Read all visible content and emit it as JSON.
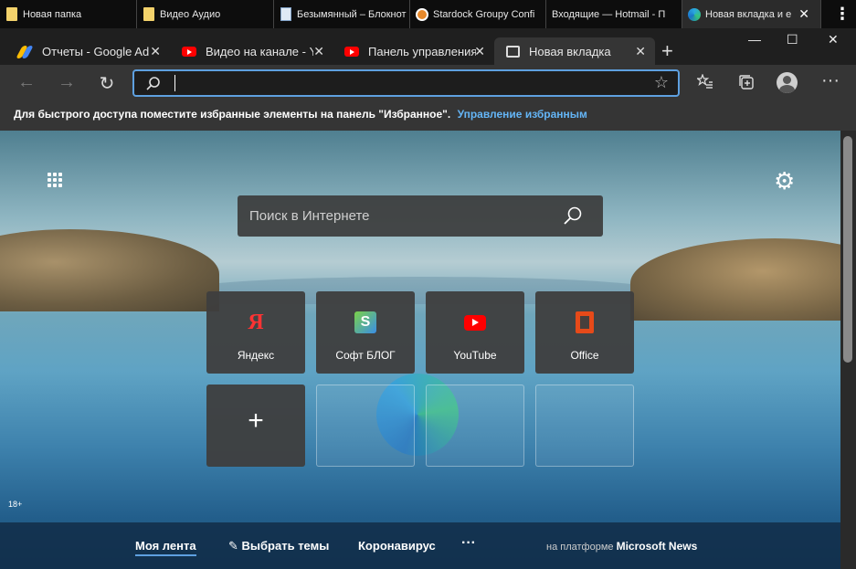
{
  "group_tabs": [
    {
      "label": "Новая папка",
      "icon": "folder-icon"
    },
    {
      "label": "Видео Аудио",
      "icon": "folder-icon"
    },
    {
      "label": "Безымянный – Блокнот",
      "icon": "notepad-icon"
    },
    {
      "label": "Stardock Groupy Confi",
      "icon": "stardock-icon"
    },
    {
      "label": "Входящие — Hotmail - П",
      "icon": "none"
    },
    {
      "label": "Новая вкладка и е",
      "icon": "edge-icon"
    }
  ],
  "tabs": [
    {
      "label": "Отчеты - Google Ad",
      "icon": "google-ads-icon"
    },
    {
      "label": "Видео на канале - Yo",
      "icon": "youtube-icon"
    },
    {
      "label": "Панель управления",
      "icon": "youtube-icon"
    },
    {
      "label": "Новая вкладка",
      "icon": "new-tab-icon"
    }
  ],
  "address_bar": {
    "value": ""
  },
  "favorites_bar": {
    "hint": "Для быстрого доступа поместите избранные элементы на панель \"Избранное\".",
    "link": "Управление избранным"
  },
  "newtab": {
    "search_placeholder": "Поиск в Интернете",
    "age_rating": "18+",
    "tiles": [
      {
        "label": "Яндекс",
        "icon": "yandex-icon"
      },
      {
        "label": "Софт БЛОГ",
        "icon": "softblog-icon"
      },
      {
        "label": "YouTube",
        "icon": "youtube-icon"
      },
      {
        "label": "Office",
        "icon": "office-icon"
      }
    ],
    "feed": {
      "my_feed": "Моя лента",
      "choose_topics": "Выбрать темы",
      "coronavirus": "Коронавирус",
      "more": "···",
      "platform_prefix": "на платформе",
      "platform_name": "Microsoft News"
    }
  },
  "colors": {
    "accent": "#5ea0e0",
    "link": "#64b5f6"
  }
}
